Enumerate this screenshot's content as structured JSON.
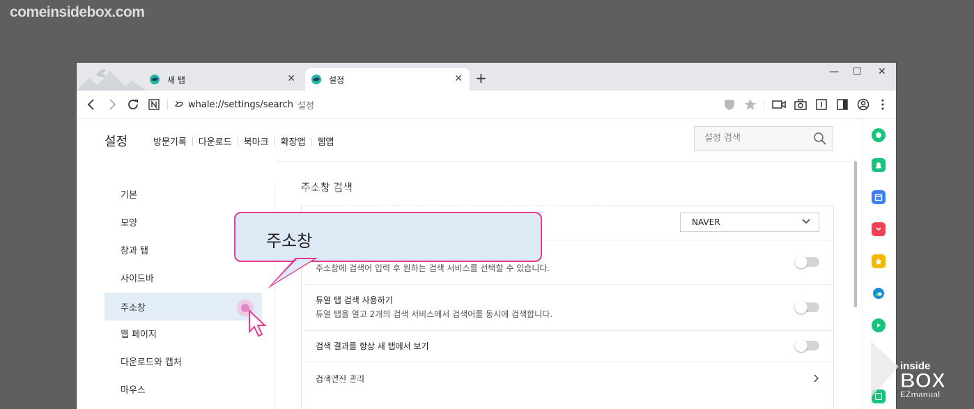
{
  "watermark": {
    "site": "comeinsidebox.com",
    "center": "comeinsidebox.com",
    "bottom": "insideBox Ezmanual",
    "logo_line1": "inside",
    "logo_line2": "BOX",
    "logo_line3": "EZmanual"
  },
  "tabs": [
    {
      "title": "새 탭",
      "icon": "whale-icon",
      "active": false
    },
    {
      "title": "설정",
      "icon": "whale-icon",
      "active": true
    }
  ],
  "new_tab_symbol": "+",
  "window_controls": {
    "minimize": "—",
    "maximize": "☐",
    "close": "✕"
  },
  "address": {
    "url": "whale://settings/search",
    "page_label": "설정"
  },
  "settings_header": {
    "title": "설정",
    "nav": [
      "방문기록",
      "다운로드",
      "북마크",
      "확장앱",
      "웹앱"
    ],
    "search_placeholder": "설정 검색"
  },
  "left_menu": {
    "items": [
      "기본",
      "모양",
      "창과 탭",
      "사이드바",
      "주소창",
      "웹 페이지",
      "다운로드와 캡처",
      "마우스"
    ],
    "selected": "주소창"
  },
  "main": {
    "section_title": "주소창 검색",
    "engine_select": {
      "value": "NAVER"
    },
    "rows": [
      {
        "desc": "주소창에 검색어 입력 후 원하는 검색 서비스를 선택할 수 있습니다.",
        "toggle": false
      },
      {
        "title": "듀얼 탭 검색 사용하기",
        "desc": "듀얼 탭을 열고 2개의 검색 서비스에서 검색어를 동시에 검색합니다.",
        "toggle": false
      },
      {
        "title": "검색 결과를 항상 새 탭에서 보기",
        "toggle": false
      },
      {
        "title": "검색엔진 관리"
      }
    ]
  },
  "callout": {
    "text": "주소창",
    "border_color": "#e33a8d",
    "bg_color": "#dde9f5"
  },
  "sidebar_icons": [
    "green-circle-icon",
    "bell-icon",
    "calendar-icon",
    "pocket-icon",
    "star-icon",
    "edge-icon",
    "play-icon",
    "square-icon"
  ],
  "colors": {
    "accent": "#e33a8d",
    "selected_bg": "#e3edf8"
  }
}
